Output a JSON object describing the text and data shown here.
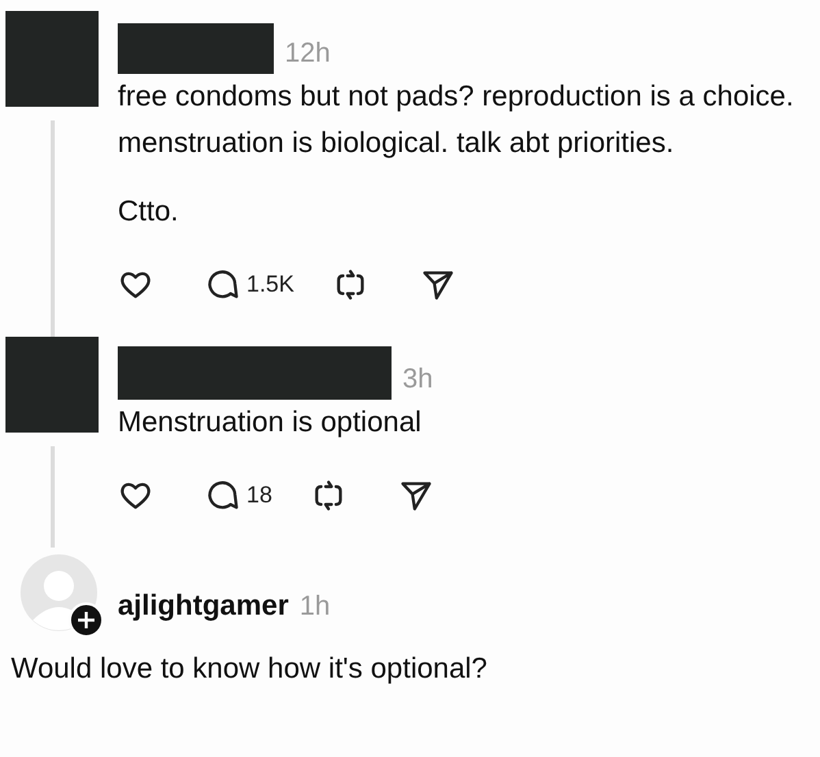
{
  "posts": [
    {
      "avatar": {
        "kind": "redacted"
      },
      "author": {
        "redacted": true
      },
      "time": "12h",
      "paragraphs": [
        "free condoms but not pads? reproduction is a choice. menstruation is biological. talk abt priorities.",
        "Ctto."
      ],
      "thread_line": true,
      "actions": [
        {
          "kind": "like"
        },
        {
          "kind": "comment",
          "count": "1.5K"
        },
        {
          "kind": "repost"
        },
        {
          "kind": "share"
        }
      ]
    },
    {
      "avatar": {
        "kind": "redacted"
      },
      "author": {
        "redacted": true
      },
      "time": "3h",
      "paragraphs": [
        "Menstruation is optional"
      ],
      "thread_line": true,
      "actions": [
        {
          "kind": "like"
        },
        {
          "kind": "comment",
          "count": "18"
        },
        {
          "kind": "repost"
        },
        {
          "kind": "share"
        }
      ]
    },
    {
      "avatar": {
        "kind": "default",
        "follow_badge": true
      },
      "author": {
        "redacted": false,
        "name": "ajlightgamer"
      },
      "time": "1h",
      "paragraphs": [
        "Would love to know how it's optional?"
      ],
      "thread_line": false
    }
  ]
}
